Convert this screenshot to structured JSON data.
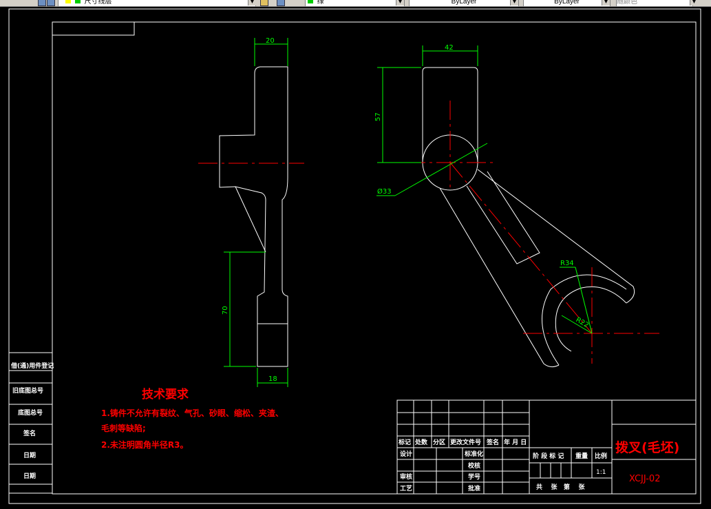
{
  "toolbar": {
    "layer_name": "尺寸线层",
    "color_name": "绿",
    "linetype_1": "ByLayer",
    "linetype_2": "ByLayer",
    "plotstyle": "随颜色"
  },
  "colors": {
    "outline": "#ffffff",
    "centerline": "#ff0000",
    "dimension": "#00ff00",
    "text_red": "#ff0000"
  },
  "dimensions": {
    "d20": "20",
    "d70": "70",
    "d18": "18",
    "d42": "42",
    "d57": "57",
    "d33": "Ø33",
    "r34": "R34",
    "r22": "R22"
  },
  "tech_notes": {
    "title": "技术要求",
    "line1": "1.铸件不允许有裂纹、气孔、砂眼、缩松、夹渣、",
    "line2": "毛刺等缺陷;",
    "line3": "2.未注明圆角半径R3。"
  },
  "left_block": {
    "row1": "借(通)用件登记",
    "row2": "旧底图总号",
    "row3": "底图总号",
    "row4": "签名",
    "row5": "日期",
    "row6": "日期"
  },
  "title_block": {
    "h_mark": "标记",
    "h_count": "处数",
    "h_zone": "分区",
    "h_docno": "更改文件号",
    "h_sign": "签名",
    "h_date": "年 月 日",
    "design": "设计",
    "standard": "标准化",
    "review": "审核",
    "process": "工艺",
    "check": "校核",
    "number": "学号",
    "approve": "批准",
    "stage": "阶 段 标 记",
    "weight": "重量",
    "scale": "比例",
    "scale_value": "1:1",
    "sheets": "共    张   第    张",
    "part_name": "拨叉(毛坯)",
    "drawing_no": "XCJJ-02"
  }
}
